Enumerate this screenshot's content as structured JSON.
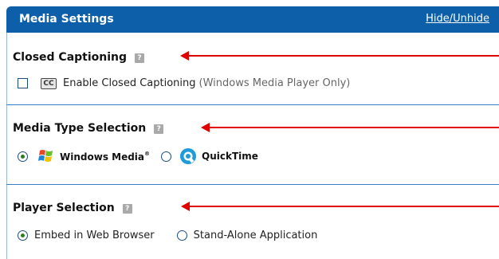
{
  "header": {
    "title": "Media Settings",
    "toggle_link": "Hide/Unhide"
  },
  "closed_captioning": {
    "title": "Closed Captioning",
    "help_glyph": "?",
    "cc_icon_text": "CC",
    "checkbox_label": "Enable Closed Captioning",
    "checkbox_note": "(Windows Media Player Only)",
    "checked": false
  },
  "media_type": {
    "title": "Media Type Selection",
    "help_glyph": "?",
    "options": [
      {
        "label": "Windows Media",
        "trademark": "®",
        "selected": true
      },
      {
        "label": "QuickTime",
        "selected": false
      }
    ]
  },
  "player": {
    "title": "Player Selection",
    "help_glyph": "?",
    "options": [
      {
        "label": "Embed in Web Browser",
        "selected": true
      },
      {
        "label": "Stand-Alone Application",
        "selected": false
      }
    ]
  },
  "colors": {
    "header_bg": "#0c5fa8",
    "annotation_arrow": "#e00000",
    "divider": "#3a7fc5"
  }
}
